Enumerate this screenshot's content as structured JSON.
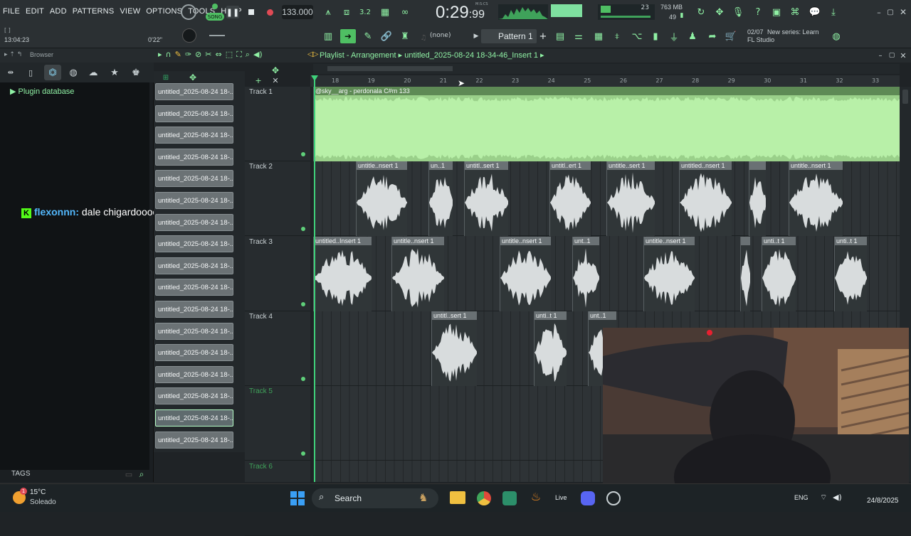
{
  "menu": [
    "FILE",
    "EDIT",
    "ADD",
    "PATTERNS",
    "VIEW",
    "OPTIONS",
    "TOOLS",
    "HELP"
  ],
  "transport": {
    "song_label": "SONG",
    "tempo": "133.000",
    "time_main": "0:29",
    "time_sub": ":99",
    "time_caption": "M:S:CS",
    "cpu_num": "23",
    "memory": "763 MB",
    "poly": "49"
  },
  "hint": {
    "clock": "13:04:23",
    "offset": "0'22\"",
    "brackets": "[ ]"
  },
  "pattern": {
    "none_label": "(none)",
    "pattern_label": "Pattern 1"
  },
  "news": {
    "count": "02/07",
    "line1": "New series: Learn",
    "line2": "FL Studio"
  },
  "browser": {
    "title": "Browser",
    "root": "Plugin database",
    "tags_label": "TAGS"
  },
  "playlist": {
    "title": "Playlist - Arrangement",
    "file": "untitled_2025-08-24 18-34-46_Insert 1",
    "bars": [
      "18",
      "19",
      "20",
      "21",
      "22",
      "23",
      "24",
      "25",
      "26",
      "27",
      "28",
      "29",
      "30",
      "31",
      "32",
      "33"
    ]
  },
  "patterns": [
    "untitled_2025-08-24 18-...",
    "untitled_2025-08-24 18-...",
    "untitled_2025-08-24 18-...",
    "untitled_2025-08-24 18-...",
    "untitled_2025-08-24 18-...",
    "untitled_2025-08-24 18-...",
    "untitled_2025-08-24 18-...",
    "untitled_2025-08-24 18-...",
    "untitled_2025-08-24 18-...",
    "untitled_2025-08-24 18-...",
    "untitled_2025-08-24 18-...",
    "untitled_2025-08-24 18-...",
    "untitled_2025-08-24 18-...",
    "untitled_2025-08-24 18-...",
    "untitled_2025-08-24 18-...",
    "untitled_2025-08-24 18-...",
    "untitled_2025-08-24 18-..."
  ],
  "tracks": [
    "Track 1",
    "Track 2",
    "Track 3",
    "Track 4",
    "Track 5",
    "Track 6"
  ],
  "clips": {
    "t1": "@sky__arg - perdonala C#m 133",
    "t2": [
      "untitle..nsert 1",
      "un..1",
      "untitl..sert 1",
      "untitl..ert 1",
      "untitle..sert 1",
      "untitled..nsert 1",
      "",
      "untitle..nsert 1"
    ],
    "t3": [
      "untitled..Insert 1",
      "untitle..nsert 1",
      "untitle..nsert 1",
      "unt..1",
      "untitle..nsert 1",
      "",
      "unti..t 1",
      "unti..t 1"
    ],
    "t4": [
      "untitl..sert 1",
      "unti..t 1",
      "unt..1"
    ]
  },
  "chat": {
    "user": "flexonnn:",
    "message": "dale chigardoooo"
  },
  "taskbar": {
    "temp": "15°C",
    "weather": "Soleado",
    "search": "Search",
    "lang": "ENG",
    "date": "24/8/2025",
    "live": "Live"
  },
  "colors": {
    "accent": "#4fbf63",
    "audio_main": "#b8f0a8",
    "clip_wave": "#d8dcdd"
  }
}
